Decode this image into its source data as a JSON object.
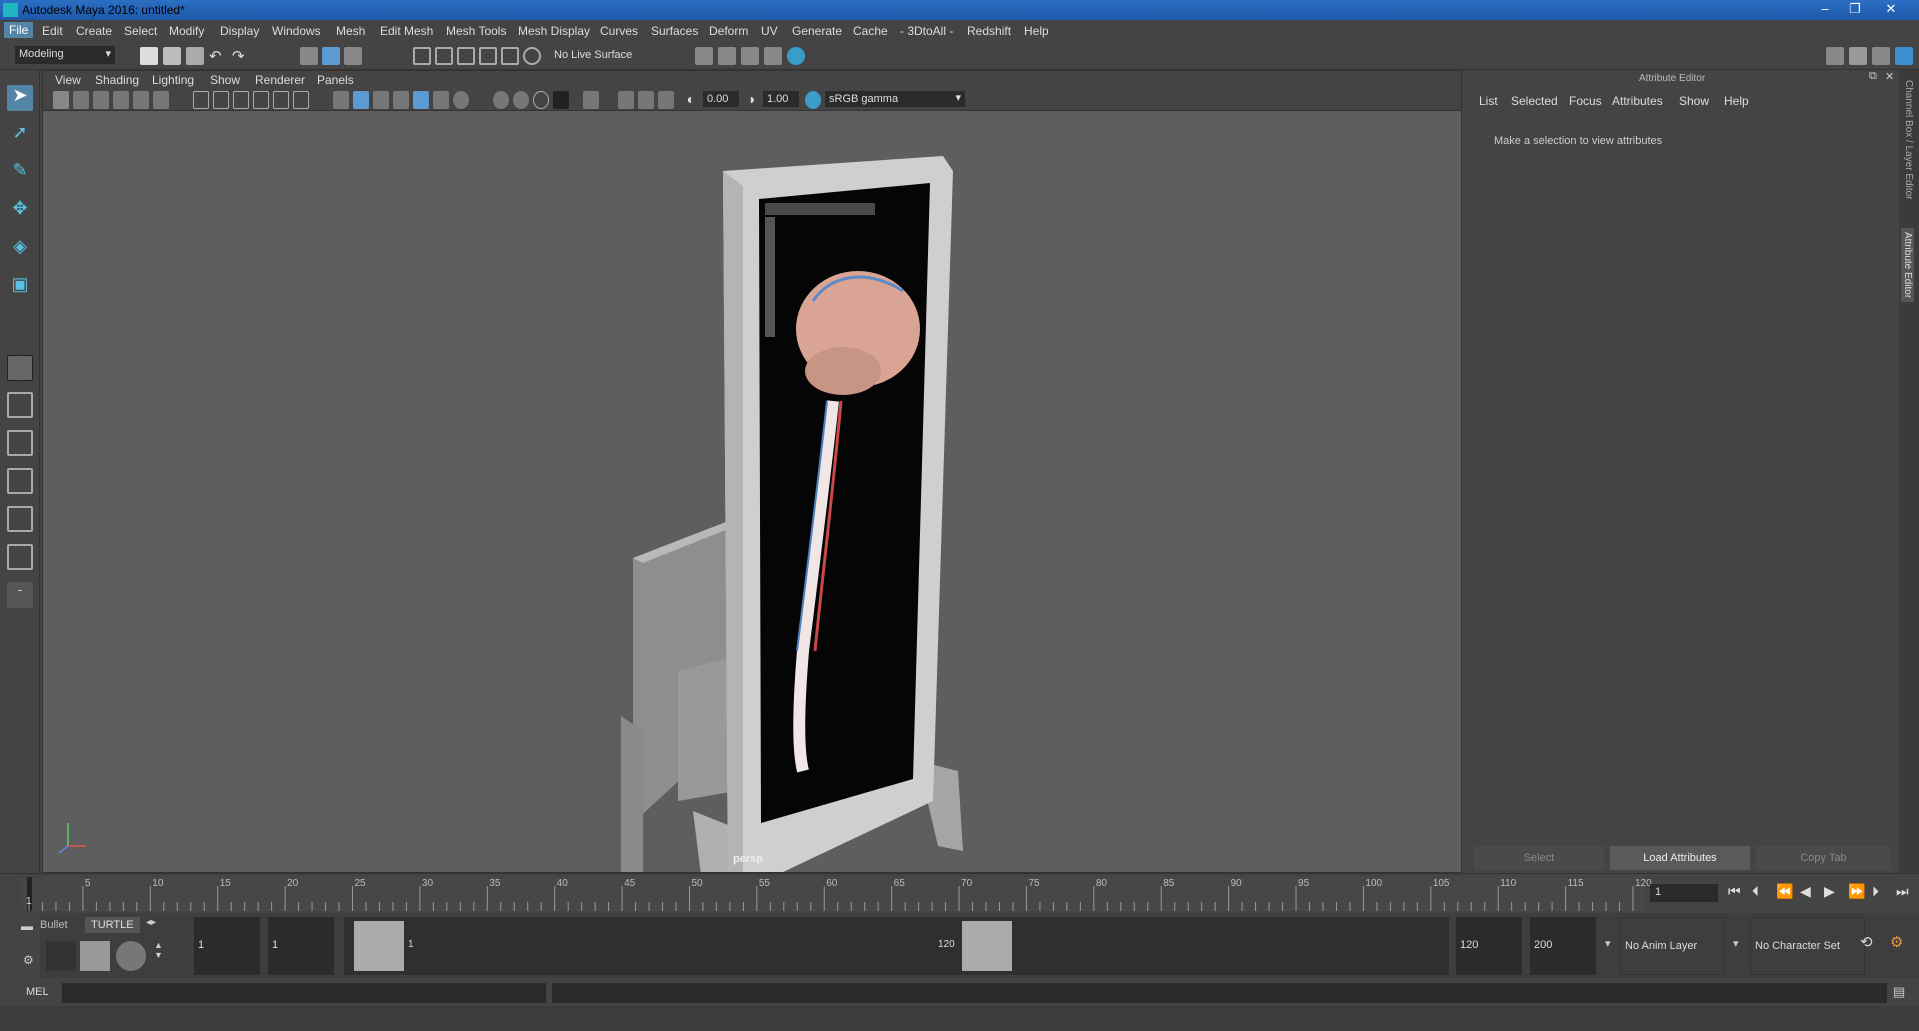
{
  "window": {
    "title": "Autodesk Maya 2016: untitled*",
    "min": "–",
    "max": "❐",
    "close": "✕"
  },
  "menus": [
    "File",
    "Edit",
    "Create",
    "Select",
    "Modify",
    "Display",
    "Windows",
    "Mesh",
    "Edit Mesh",
    "Mesh Tools",
    "Mesh Display",
    "Curves",
    "Surfaces",
    "Deform",
    "UV",
    "Generate",
    "Cache",
    "- 3DtoAll -",
    "Redshift",
    "Help"
  ],
  "shelf": {
    "mode": "Modeling",
    "live_surface": "No Live Surface"
  },
  "viewport": {
    "menus": [
      "View",
      "Shading",
      "Lighting",
      "Show",
      "Renderer",
      "Panels"
    ],
    "exposure": "0.00",
    "gamma": "1.00",
    "color_space": "sRGB gamma",
    "camera_label": "persp"
  },
  "attribute_editor": {
    "title": "Attribute Editor",
    "menus": [
      "List",
      "Selected",
      "Focus",
      "Attributes",
      "Show",
      "Help"
    ],
    "message": "Make a selection to view attributes",
    "buttons": {
      "select": "Select",
      "load": "Load Attributes",
      "copy": "Copy Tab"
    },
    "side_tabs": {
      "channel_box": "Channel Box / Layer Editor",
      "attribute_editor": "Attribute Editor"
    }
  },
  "timeline": {
    "ticks": [
      "5",
      "10",
      "15",
      "20",
      "25",
      "30",
      "35",
      "40",
      "45",
      "50",
      "55",
      "60",
      "65",
      "70",
      "75",
      "80",
      "85",
      "90",
      "95",
      "100",
      "105",
      "110",
      "115",
      "120"
    ],
    "start_tick": "1",
    "current_frame": "1"
  },
  "range": {
    "shelf_tabs": [
      "Bullet",
      "TURTLE"
    ],
    "start": "1",
    "playback_start": "1",
    "slider_start": "1",
    "slider_end": "120",
    "playback_end": "120",
    "end": "200",
    "anim_layer": "No Anim Layer",
    "character_set": "No Character Set"
  },
  "command_line": {
    "label": "MEL"
  }
}
